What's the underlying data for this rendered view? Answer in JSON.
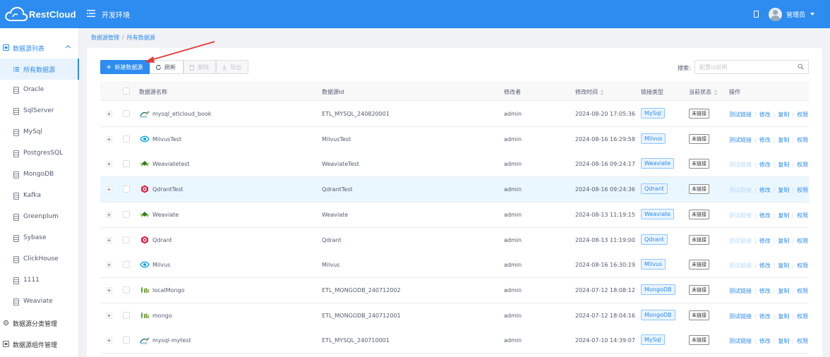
{
  "app": {
    "name": "RestCloud",
    "environment": "开发环境"
  },
  "user": {
    "name": "管理员"
  },
  "sidebar": {
    "group_list": "数据源列表",
    "items": [
      {
        "label": "所有数据源",
        "active": true
      },
      {
        "label": "Oracle"
      },
      {
        "label": "SqlServer"
      },
      {
        "label": "MySql"
      },
      {
        "label": "PostgresSQL"
      },
      {
        "label": "MongoDB"
      },
      {
        "label": "Kafka"
      },
      {
        "label": "Greenplum"
      },
      {
        "label": "Sybase"
      },
      {
        "label": "ClickHouse"
      },
      {
        "label": "1111"
      },
      {
        "label": "Weaviate"
      }
    ],
    "group_category": "数据源分类管理",
    "group_component": "数据源组件管理"
  },
  "breadcrumb": {
    "parent": "数据源管理",
    "current": "所有数据源"
  },
  "toolbar": {
    "new_label": "新建数据源",
    "refresh_label": "刷新",
    "delete_label": "删除",
    "export_label": "导出"
  },
  "search": {
    "label": "搜索:",
    "placeholder": "配置id说明"
  },
  "table": {
    "headers": {
      "name": "数据源名称",
      "id": "数据源Id",
      "editor": "修改者",
      "time": "修改时间",
      "type": "链接类型",
      "status": "当前状态",
      "ops": "操作"
    },
    "ops": {
      "test": "测试链接",
      "edit": "修改",
      "copy": "复制",
      "perm": "权限"
    },
    "rows": [
      {
        "name": "mysql_etlcloud_book",
        "id": "ETL_MYSQL_240820001",
        "editor": "admin",
        "time": "2024-08-20 17:05:36",
        "type": "MySql",
        "status": "未链接",
        "icon": "mysql-icon",
        "test_enabled": true
      },
      {
        "name": "MilvusTest",
        "id": "MilvusTest",
        "editor": "admin",
        "time": "2024-08-16 16:29:58",
        "type": "Milvus",
        "status": "未链接",
        "icon": "milvus-icon",
        "test_enabled": true
      },
      {
        "name": "Weaviatetest",
        "id": "WeaviateTest",
        "editor": "admin",
        "time": "2024-08-16 09:24:17",
        "type": "Weaviate",
        "status": "未链接",
        "icon": "weaviate-icon",
        "test_enabled": false
      },
      {
        "name": "QdrantTest",
        "id": "QdrantTest",
        "editor": "admin",
        "time": "2024-08-16 09:24:36",
        "type": "Qdrant",
        "status": "未链接",
        "icon": "qdrant-icon",
        "test_enabled": false
      },
      {
        "name": "Weaviate",
        "id": "Weaviate",
        "editor": "admin",
        "time": "2024-08-13 11:19:15",
        "type": "Weaviate",
        "status": "未链接",
        "icon": "weaviate-icon",
        "test_enabled": false
      },
      {
        "name": "Qdrant",
        "id": "Qdrant",
        "editor": "admin",
        "time": "2024-08-13 11:19:00",
        "type": "Qdrant",
        "status": "未链接",
        "icon": "qdrant-icon",
        "test_enabled": false
      },
      {
        "name": "Milvus",
        "id": "Milvus",
        "editor": "admin",
        "time": "2024-08-16 16:30:19",
        "type": "Milvus",
        "status": "未链接",
        "icon": "milvus-icon",
        "test_enabled": false
      },
      {
        "name": "localMongo",
        "id": "ETL_MONGODB_240712002",
        "editor": "admin",
        "time": "2024-07-12 18:08:12",
        "type": "MongoDB",
        "status": "未链接",
        "icon": "mongodb-icon",
        "test_enabled": true
      },
      {
        "name": "mongo",
        "id": "ETL_MONGODB_240712001",
        "editor": "admin",
        "time": "2024-07-12 18:04:16",
        "type": "MongoDB",
        "status": "未链接",
        "icon": "mongodb-icon",
        "test_enabled": true
      },
      {
        "name": "mysql-mytest",
        "id": "ETL_MYSQL_240710001",
        "editor": "admin",
        "time": "2024-07-10 14:39:07",
        "type": "MySql",
        "status": "未链接",
        "icon": "mysql-icon",
        "test_enabled": true
      }
    ]
  },
  "colors": {
    "accent": "#2d8cf0",
    "annotation_arrow": "#e53935"
  }
}
